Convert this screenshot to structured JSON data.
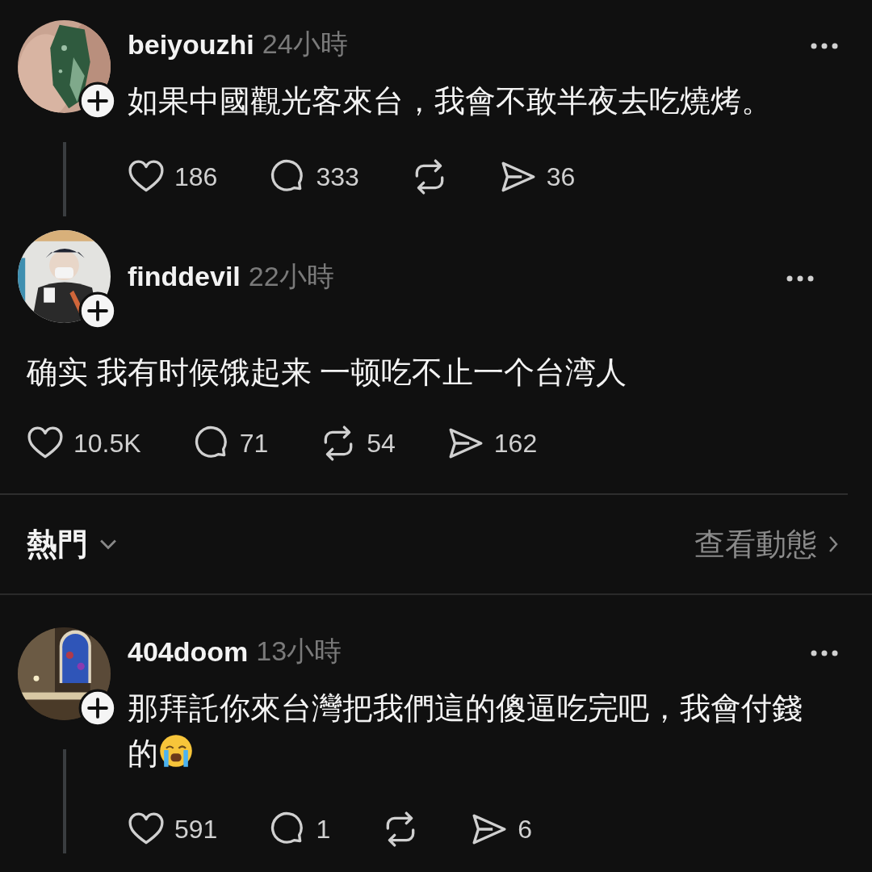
{
  "posts": [
    {
      "kind": "reply",
      "username": "beiyouzhi",
      "time": "24小時",
      "text": "如果中國觀光客來台，我會不敢半夜去吃燒烤。",
      "stats": [
        {
          "kind": "like",
          "count": "186"
        },
        {
          "kind": "comment",
          "count": "333"
        },
        {
          "kind": "repost"
        },
        {
          "kind": "share",
          "count": "36"
        }
      ]
    },
    {
      "kind": "main",
      "username": "finddevil",
      "time": "22小時",
      "text": "确实 我有时候饿起来 一顿吃不止一个台湾人",
      "stats": [
        {
          "kind": "like",
          "count": "10.5K"
        },
        {
          "kind": "comment",
          "count": "71"
        },
        {
          "kind": "repost",
          "count": "54"
        },
        {
          "kind": "share",
          "count": "162"
        }
      ]
    },
    {
      "kind": "sort_bar",
      "label": "熱門",
      "link": "查看動態"
    },
    {
      "kind": "reply",
      "username": "404doom",
      "time": "13小時",
      "text": "那拜託你來台灣把我們這的傻逼吃完吧，我會付錢的",
      "emoji": true,
      "stats": [
        {
          "kind": "like",
          "count": "591"
        },
        {
          "kind": "comment",
          "count": "1"
        },
        {
          "kind": "repost"
        },
        {
          "kind": "share",
          "count": "6"
        }
      ]
    }
  ]
}
